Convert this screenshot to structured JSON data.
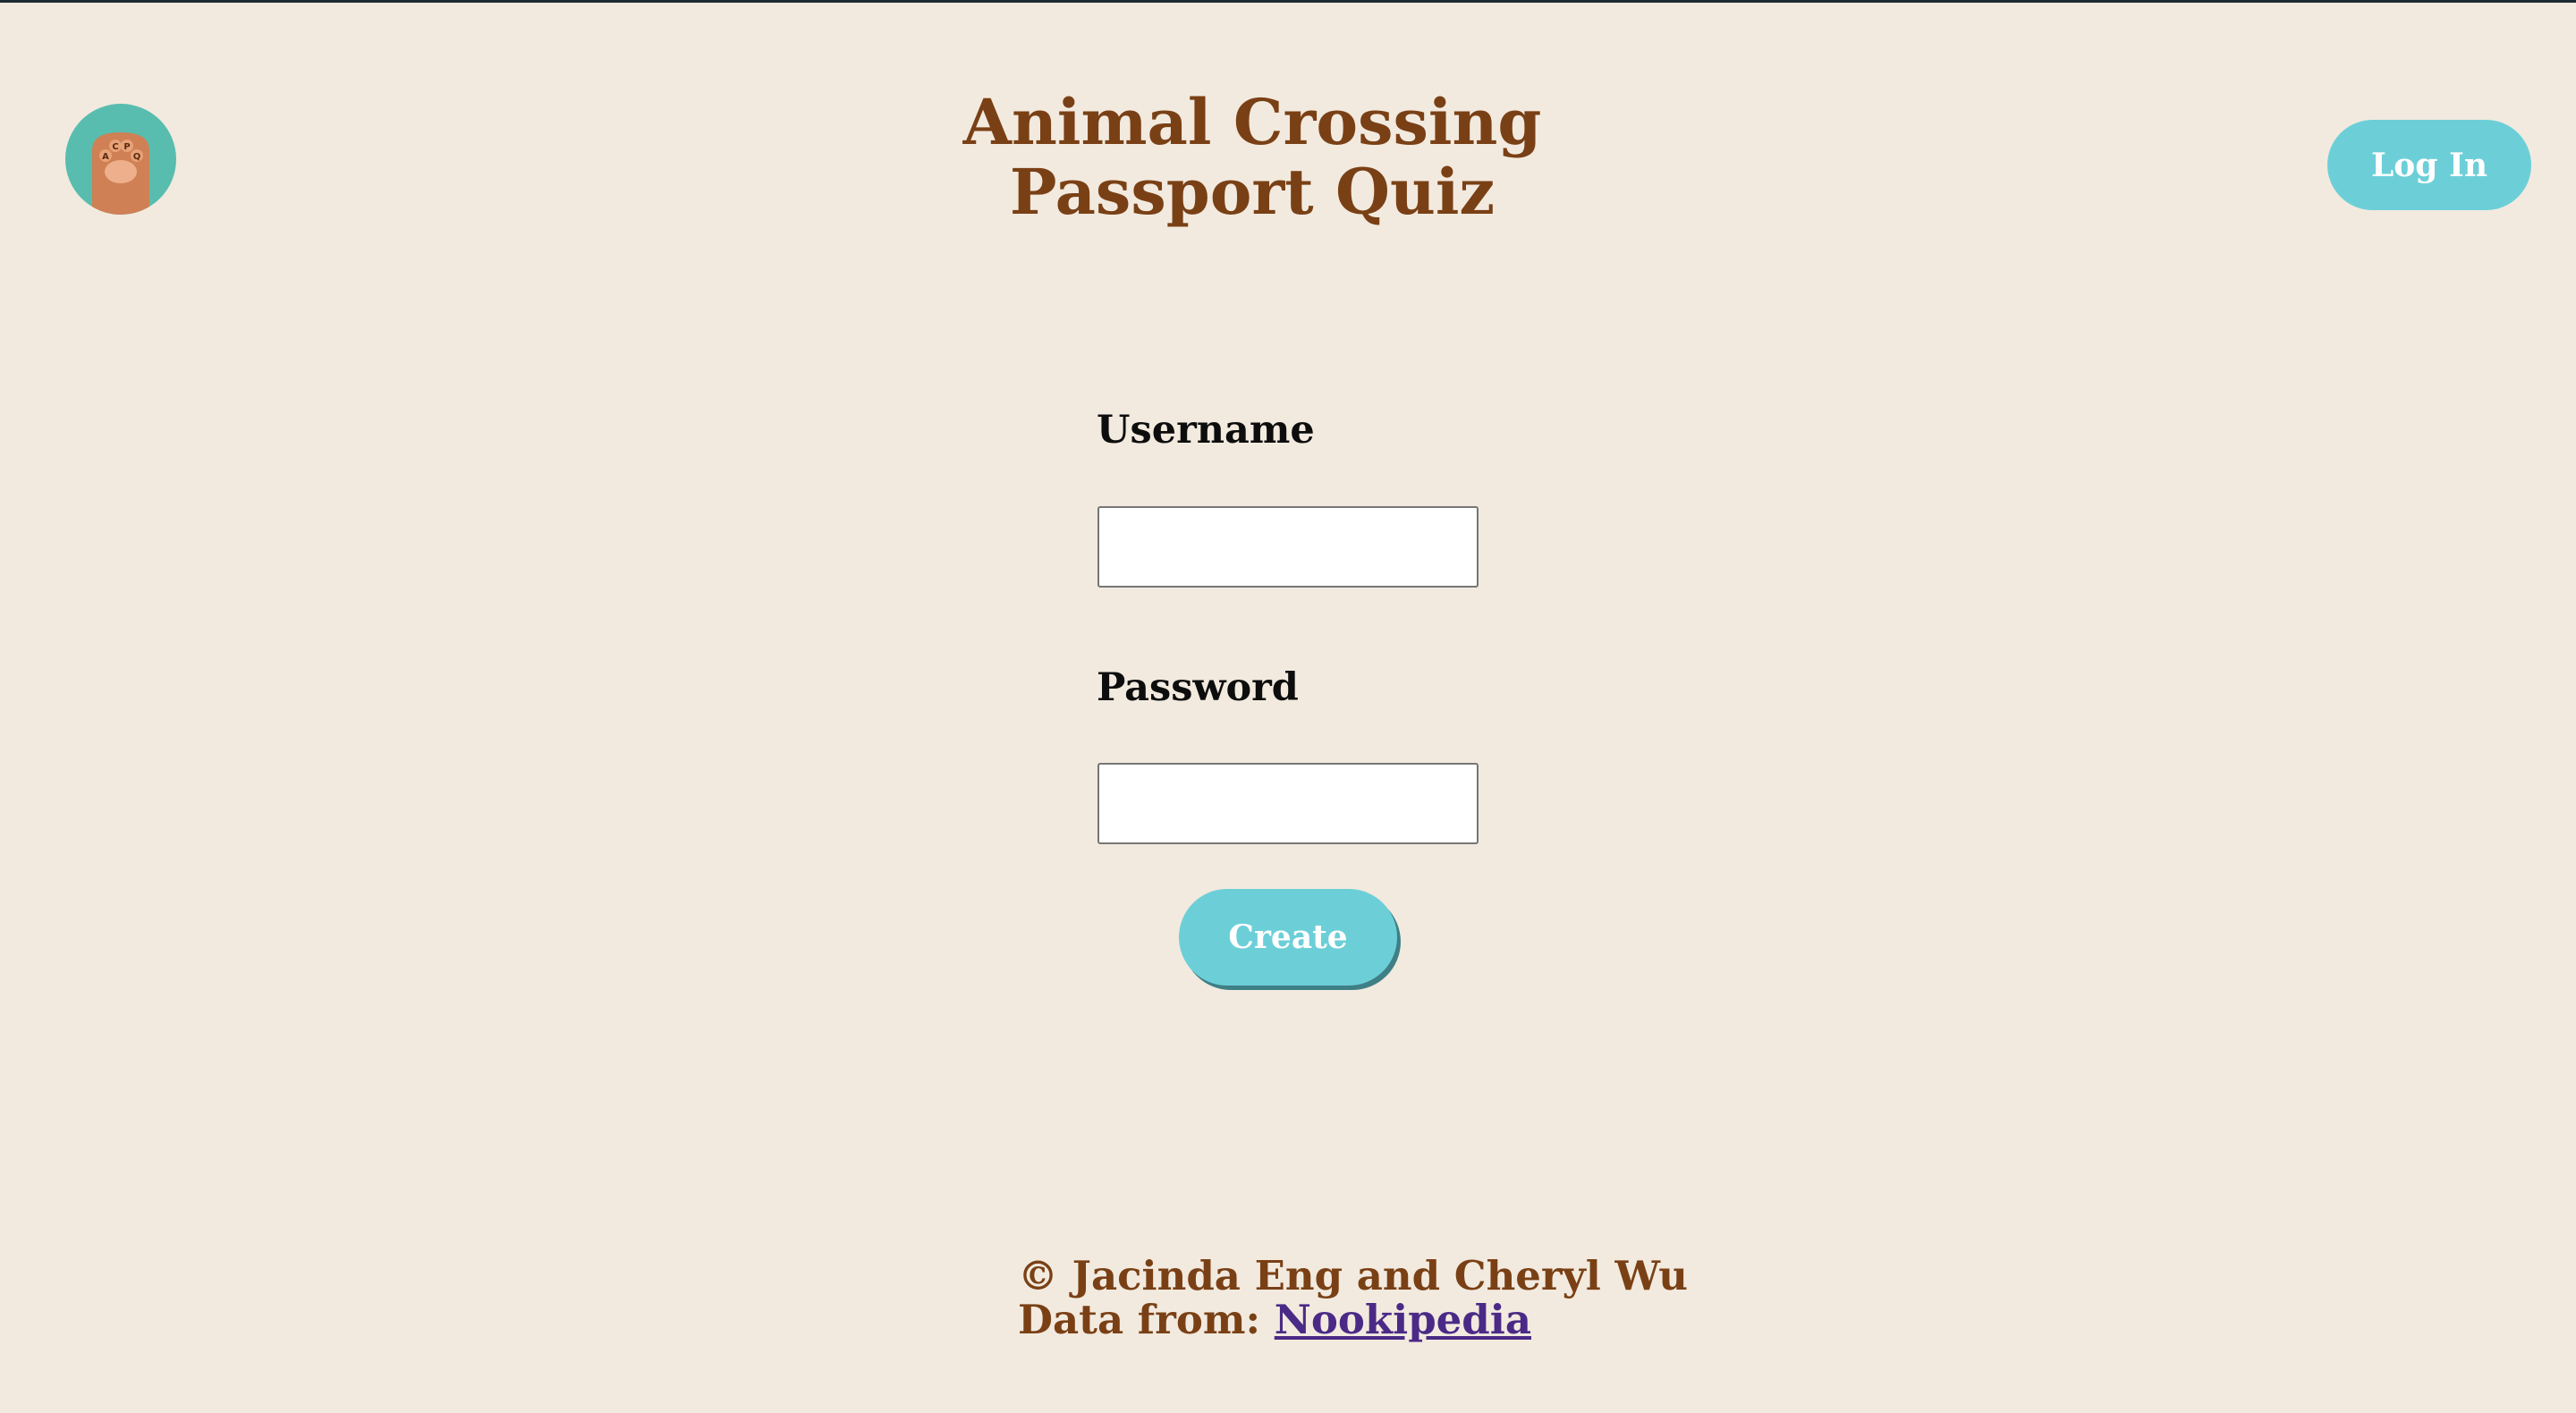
{
  "header": {
    "title": "Animal Crossing\nPassport Quiz",
    "login_label": "Log In",
    "logo_icon": "paw-logo-icon",
    "logo_text": "ACPQ"
  },
  "form": {
    "username_label": "Username",
    "username_value": "",
    "password_label": "Password",
    "password_value": "",
    "create_label": "Create"
  },
  "footer": {
    "copyright": "© Jacinda Eng and Cheryl Wu",
    "data_from_prefix": "Data from: ",
    "data_source_link": "Nookipedia"
  },
  "colors": {
    "background": "#f2eadf",
    "title_brown": "#7a4015",
    "button_teal": "#6ccfd8",
    "logo_teal": "#58bdaf",
    "link_purple": "#4a2a86"
  }
}
